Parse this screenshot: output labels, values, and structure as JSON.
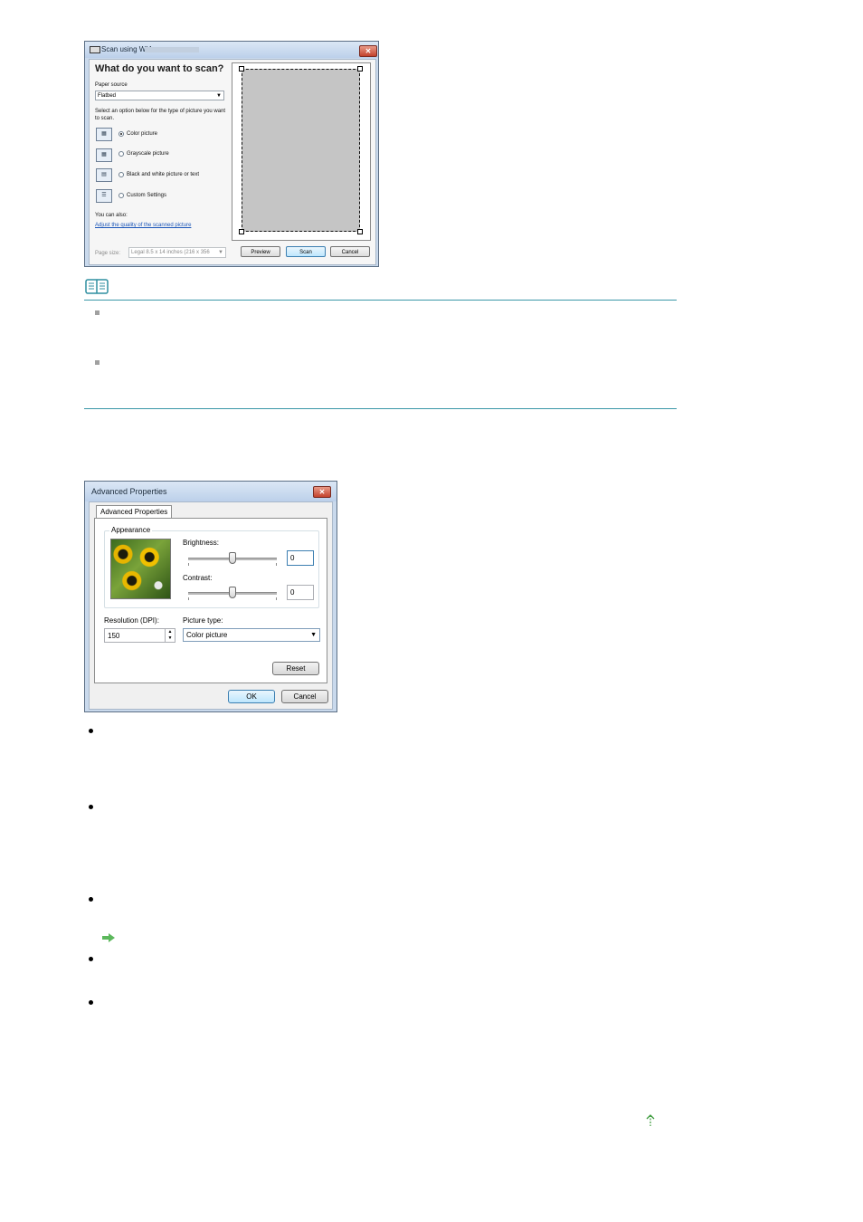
{
  "scan_dialog": {
    "title": "Scan using WIA",
    "heading": "What do you want to scan?",
    "paper_source_label": "Paper source",
    "paper_source_value": "Flatbed",
    "instruction": "Select an option below for the type of picture you want to scan.",
    "options": [
      {
        "label": "Color picture",
        "selected": true,
        "icon": "color-picture-icon"
      },
      {
        "label": "Grayscale picture",
        "selected": false,
        "icon": "grayscale-picture-icon"
      },
      {
        "label": "Black and white picture or text",
        "selected": false,
        "icon": "bw-text-icon"
      },
      {
        "label": "Custom Settings",
        "selected": false,
        "icon": "custom-settings-icon"
      }
    ],
    "also_label": "You can also:",
    "adjust_link": "Adjust the quality of the scanned picture",
    "page_size_label": "Page size:",
    "page_size_value": "Legal 8.5 x 14 inches (216 x 356",
    "buttons": {
      "preview": "Preview",
      "scan": "Scan",
      "cancel": "Cancel"
    }
  },
  "advanced_dialog": {
    "title": "Advanced Properties",
    "tab": "Advanced Properties",
    "appearance_label": "Appearance",
    "brightness_label": "Brightness:",
    "brightness_value": "0",
    "contrast_label": "Contrast:",
    "contrast_value": "0",
    "resolution_label": "Resolution (DPI):",
    "resolution_value": "150",
    "picture_type_label": "Picture type:",
    "picture_type_value": "Color picture",
    "buttons": {
      "reset": "Reset",
      "ok": "OK",
      "cancel": "Cancel"
    }
  },
  "colors": {
    "note_rule": "#3b97a8",
    "link": "#1a55b8",
    "arrow_green": "#5cb85c"
  }
}
